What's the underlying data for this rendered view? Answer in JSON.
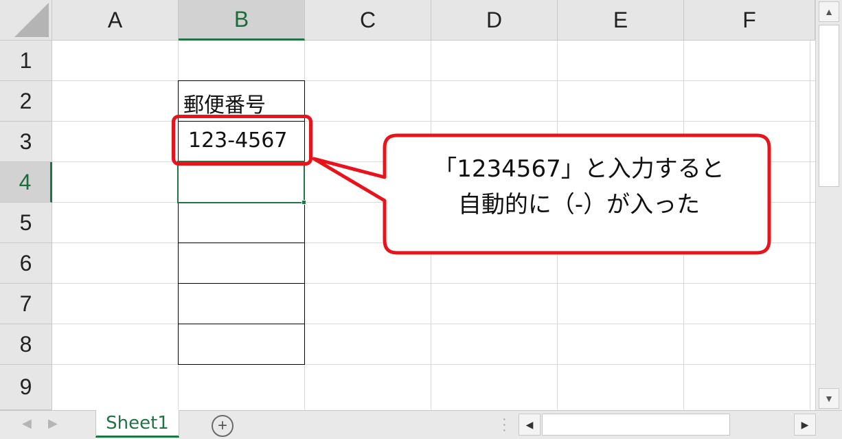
{
  "columns": [
    "A",
    "B",
    "C",
    "D",
    "E",
    "F"
  ],
  "rows": [
    "1",
    "2",
    "3",
    "4",
    "5",
    "6",
    "7",
    "8",
    "9"
  ],
  "selected_column": "B",
  "selected_row": "4",
  "cells": {
    "B2": "郵便番号",
    "B3": "123-4567",
    "B4": "",
    "B5": "",
    "B6": "",
    "B7": "",
    "B8": ""
  },
  "callout": {
    "line1": "「1234567」と入力すると",
    "line2": "自動的に（-）が入った"
  },
  "sheet_tab": "Sheet1",
  "colors": {
    "accent": "#217346",
    "highlight": "#e8131b",
    "header_bg": "#e6e6e6"
  },
  "icons": [
    "select-all-triangle",
    "scroll-up-arrow",
    "scroll-down-arrow",
    "sheet-prev-arrow",
    "sheet-next-arrow",
    "add-sheet-icon",
    "scroll-left-arrow",
    "scroll-right-arrow"
  ]
}
